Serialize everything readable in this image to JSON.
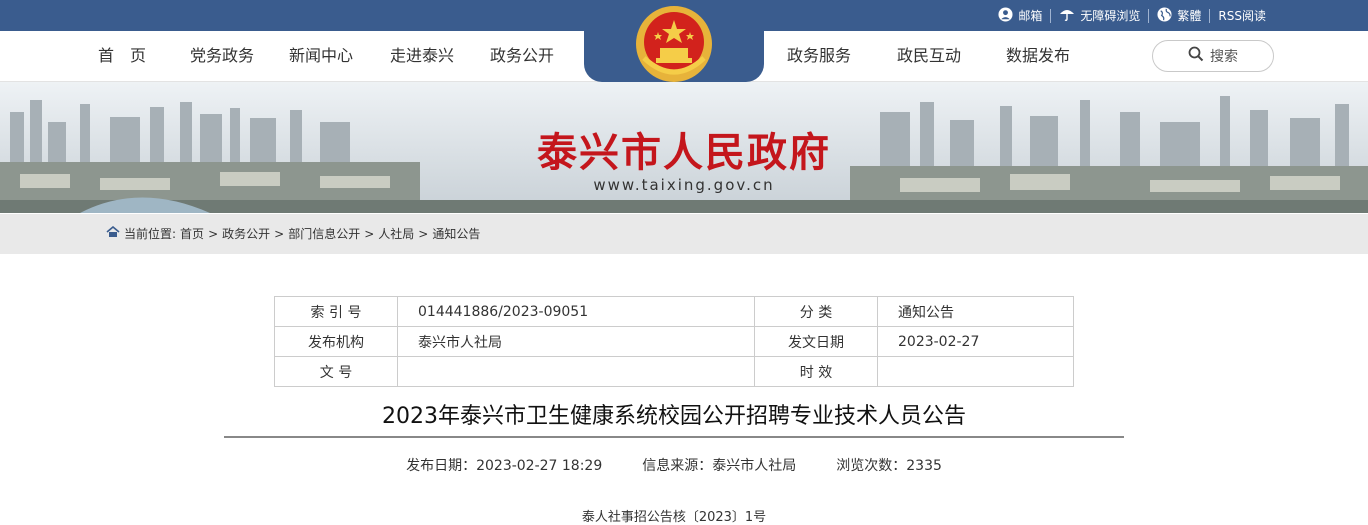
{
  "topbar": {
    "links": [
      {
        "label": "邮箱",
        "icon": "user-icon"
      },
      {
        "label": "无障碍浏览",
        "icon": "umbrella-icon"
      },
      {
        "label": "繁體",
        "icon": "globe-icon"
      },
      {
        "label": "RSS阅读",
        "icon": ""
      }
    ]
  },
  "nav": {
    "left": [
      "首　页",
      "党务政务",
      "新闻中心",
      "走进泰兴",
      "政务公开"
    ],
    "right": [
      "政务服务",
      "政民互动",
      "数据发布"
    ],
    "search_label": "搜索"
  },
  "banner": {
    "title": "泰兴市人民政府",
    "url": "www.taixing.gov.cn"
  },
  "breadcrumb": {
    "prefix": "当前位置:",
    "items": [
      "首页",
      "政务公开",
      "部门信息公开",
      "人社局",
      "通知公告"
    ]
  },
  "meta": {
    "index_label": "索 引 号",
    "index_value": "014441886/2023-09051",
    "category_label": "分 类",
    "category_value": "通知公告",
    "publisher_label": "发布机构",
    "publisher_value": "泰兴市人社局",
    "date_label": "发文日期",
    "date_value": "2023-02-27",
    "docno_label": "文 号",
    "docno_value": "",
    "validity_label": "时 效",
    "validity_value": ""
  },
  "article": {
    "title": "2023年泰兴市卫生健康系统校园公开招聘专业技术人员公告",
    "publish_date": "发布日期：2023-02-27 18:29",
    "source": "信息来源：泰兴市人社局",
    "views": "浏览次数：2335",
    "doc_number": "泰人社事招公告核〔2023〕1号"
  },
  "colors": {
    "brand_blue": "#3a5c8e",
    "title_red": "#c4161c"
  }
}
